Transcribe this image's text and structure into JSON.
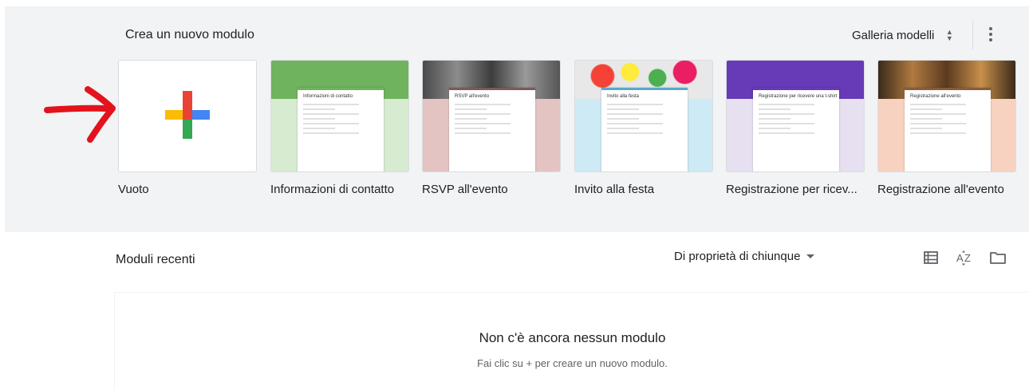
{
  "header": {
    "title": "Crea un nuovo modulo",
    "gallery_label": "Galleria modelli",
    "gallery_icon": "unfold-more-icon",
    "more_icon": "more-vert-icon"
  },
  "templates": [
    {
      "label": "Vuoto",
      "icon": "plus-icon"
    },
    {
      "label": "Informazioni di contatto",
      "form_title": "Informazioni di contatto",
      "color": "#6fb35e",
      "bg": "#d7ebd1"
    },
    {
      "label": "RSVP all'evento",
      "form_title": "RSVP all'evento",
      "color": "#7a5a5a",
      "bg": "#e3c4c2"
    },
    {
      "label": "Invito alla festa",
      "form_title": "Invito alla festa",
      "color": "#5aa9c8",
      "bg": "#cdeaf5"
    },
    {
      "label": "Registrazione per ricev...",
      "form_title": "Registrazione per ricevere una t-shirt",
      "color": "#673ab7",
      "bg": "#e6e0f0"
    },
    {
      "label": "Registrazione all'evento",
      "form_title": "Registrazione all'evento",
      "color": "#8a5a3a",
      "bg": "#f8d2c0"
    }
  ],
  "recent": {
    "title": "Moduli recenti",
    "owner_filter": "Di proprietà di chiunque",
    "list_view_icon": "list-view-icon",
    "sort_icon": "sort-az-icon",
    "folder_icon": "folder-icon",
    "empty_title": "Non c'è ancora nessun modulo",
    "empty_subtitle": "Fai clic su + per creare un nuovo modulo."
  },
  "colors": {
    "annotation_arrow": "#e3121c",
    "plus_red": "#ea4335",
    "plus_blue": "#4285f4",
    "plus_green": "#34a853",
    "plus_yellow": "#fbbc05"
  }
}
